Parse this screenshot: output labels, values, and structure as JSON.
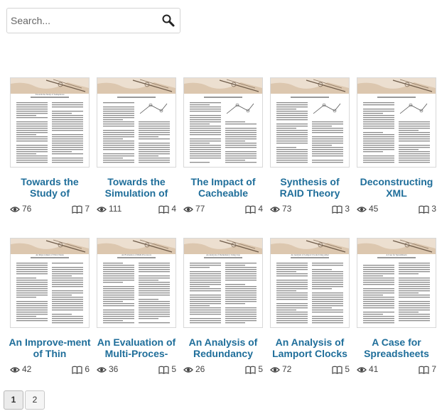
{
  "search": {
    "placeholder": "Search..."
  },
  "icons": {
    "search": "magnifier-icon",
    "views": "eye-icon",
    "reads": "open-book-icon"
  },
  "colors": {
    "title": "#1f6e9a",
    "banner": "#e7d6c3"
  },
  "papers": [
    {
      "title": "Towards the Study of",
      "views": "76",
      "reads": "7",
      "header": "Towards the Study of Semaphores"
    },
    {
      "title": "Towards the Simulation of",
      "views": "111",
      "reads": "4",
      "header": ""
    },
    {
      "title": "The Impact of Cacheable",
      "views": "77",
      "reads": "4",
      "header": ""
    },
    {
      "title": "Synthesis of RAID Theory",
      "views": "73",
      "reads": "3",
      "header": ""
    },
    {
      "title": "Deconstructing XML",
      "views": "45",
      "reads": "3",
      "header": ""
    },
    {
      "title": "An Improve-ment of Thin",
      "views": "42",
      "reads": "6",
      "header": "An Improvement of Thin Clients"
    },
    {
      "title": "An Evaluation of Multi-Proces-",
      "views": "36",
      "reads": "5",
      "header": "An Evaluation of Multi-Processors"
    },
    {
      "title": "An Analysis of Redundancy",
      "views": "26",
      "reads": "5",
      "header": "An Analysis of Redundancy Using Lisp"
    },
    {
      "title": "An Analysis of Lamport Clocks",
      "views": "72",
      "reads": "5",
      "header": "An Analysis of Lamport Clocks Using Amei"
    },
    {
      "title": "A Case for Spreadsheets",
      "views": "41",
      "reads": "7",
      "header": "A Case for Spreadsheets"
    }
  ],
  "pagination": {
    "pages": [
      "1",
      "2"
    ],
    "current": "1"
  }
}
